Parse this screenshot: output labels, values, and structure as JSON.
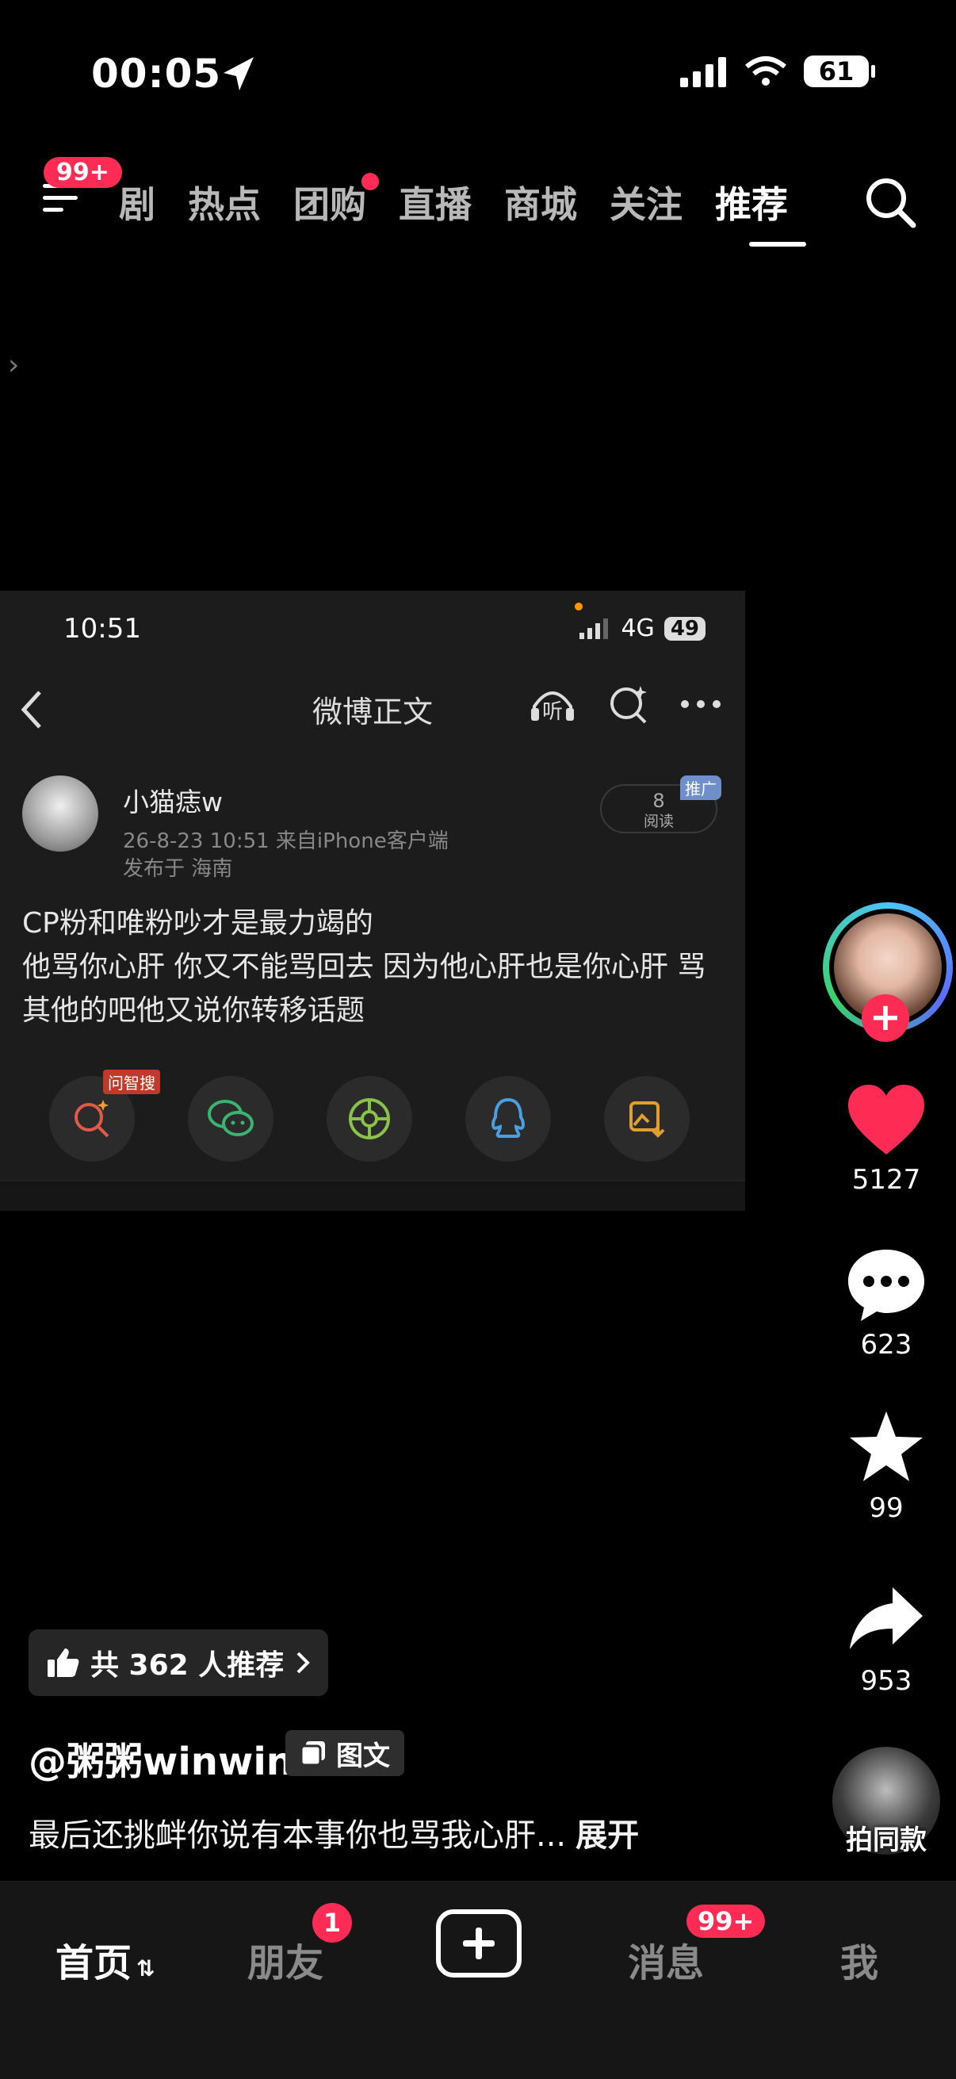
{
  "status_bar": {
    "time": "00:05",
    "battery": "61"
  },
  "top_nav": {
    "menu_badge": "99+",
    "tabs": [
      {
        "label": "剧"
      },
      {
        "label": "热点"
      },
      {
        "label": "团购"
      },
      {
        "label": "直播"
      },
      {
        "label": "商城"
      },
      {
        "label": "关注"
      },
      {
        "label": "推荐"
      }
    ],
    "active_tab": "推荐"
  },
  "embedded_post": {
    "status_time": "10:51",
    "network": "4G",
    "battery": "49",
    "page_title": "微博正文",
    "listen_label": "听",
    "username": "小猫痣w",
    "timestamp_source": "26-8-23 10:51  来自iPhone客户端",
    "location": "发布于 海南",
    "read_count": "8",
    "read_label": "阅读",
    "promo_tag": "推广",
    "content_line1": "CP粉和唯粉吵才是最力竭的",
    "content_line2": "他骂你心肝 你又不能骂回去 因为他心肝也是你心肝 骂其他的吧他又说你转移话题",
    "ask_badge": "问智搜"
  },
  "actions": {
    "likes": "5127",
    "comments": "623",
    "favorites": "99",
    "shares": "953",
    "same_style_label": "拍同款"
  },
  "post_info": {
    "recommend_label": "共 362 人推荐",
    "author": "@粥粥winwin",
    "type_label": "图文",
    "caption": "最后还挑衅你说有本事你也骂我心肝...",
    "expand_label": "展开"
  },
  "tab_bar": {
    "home": "首页",
    "friends": "朋友",
    "friends_badge": "1",
    "messages": "消息",
    "messages_badge": "99+",
    "me": "我"
  },
  "colors": {
    "accent": "#fe2c55",
    "background": "#000000"
  }
}
